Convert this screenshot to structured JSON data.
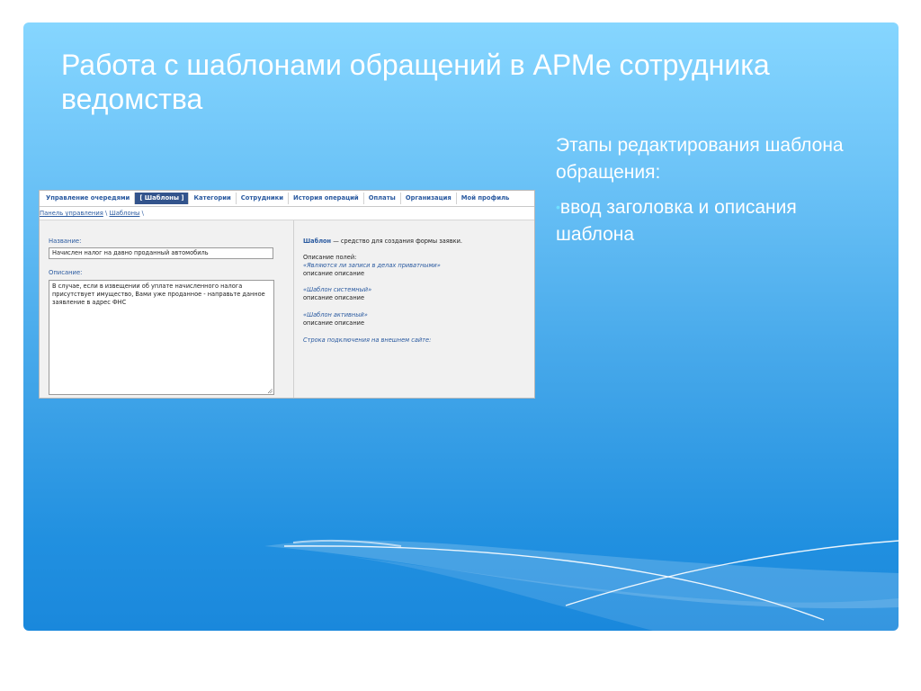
{
  "slide": {
    "title": "Работа с шаблонами обращений в АРМе сотрудника ведомства",
    "steps_heading": "Этапы редактирования шаблона обращения:",
    "steps": [
      {
        "bullet": "•",
        "text": "ввод заголовка и описания шаблона"
      }
    ]
  },
  "app": {
    "nav_tabs": [
      {
        "label": "Управление очередями",
        "active": false
      },
      {
        "label": "[ Шаблоны ]",
        "active": true
      },
      {
        "label": "Категории",
        "active": false
      },
      {
        "label": "Сотрудники",
        "active": false
      },
      {
        "label": "История операций",
        "active": false
      },
      {
        "label": "Оплаты",
        "active": false
      },
      {
        "label": "Организация",
        "active": false
      },
      {
        "label": "Мой профиль",
        "active": false
      }
    ],
    "breadcrumb": {
      "home": "Панель управления",
      "sep": "\\",
      "current": "Шаблоны",
      "tail": "\\"
    },
    "form": {
      "name_label": "Название:",
      "name_value": "Начислен налог на давно проданный автомобиль",
      "desc_label": "Описание:",
      "desc_value": "В случае, если в извещении об уплате начисленного налога присутствует имущество, Вами уже проданное - направьте данное заявление в адрес ФНС"
    },
    "help": {
      "lead_word": "Шаблон",
      "lead_rest": " — средство для создания формы заявки.",
      "fields_label": "Описание полей:",
      "items": [
        {
          "link": "«Являются ли записи в делах приватными»",
          "desc": "описание описание"
        },
        {
          "link": "«Шаблон системный»",
          "desc": "описание описание"
        },
        {
          "link": "«Шаблон активный»",
          "desc": "описание описание"
        }
      ],
      "footer_link": "Строка подключения на внешнем сайте:"
    }
  },
  "colors": {
    "slide_top": "#86d6ff",
    "slide_bottom": "#1a88dc",
    "nav_active_bg": "#33548c",
    "link": "#2a5aa0"
  }
}
